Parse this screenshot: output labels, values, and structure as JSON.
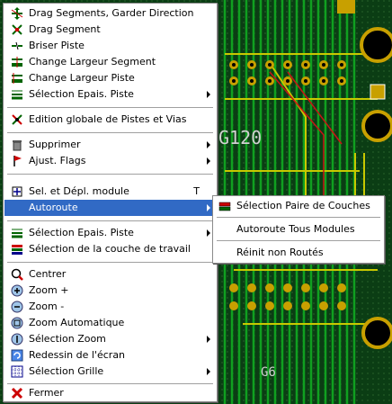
{
  "board": {
    "silk_labels": [
      "G120",
      "G6"
    ]
  },
  "menu": {
    "items": [
      {
        "label": "Drag Segments, Garder Direction",
        "icon": "drag-segments-icon",
        "submenu": false
      },
      {
        "label": "Drag Segment",
        "icon": "drag-segment-icon",
        "submenu": false
      },
      {
        "label": "Briser Piste",
        "icon": "break-track-icon",
        "submenu": false
      },
      {
        "label": "Change Largeur Segment",
        "icon": "width-segment-icon",
        "submenu": false
      },
      {
        "label": "Change Largeur Piste",
        "icon": "width-track-icon",
        "submenu": false
      },
      {
        "label": "Sélection Epais. Piste",
        "icon": "track-thickness-icon",
        "submenu": true
      },
      {
        "label": "Edition globale de Pistes et Vias",
        "icon": "global-edit-icon",
        "submenu": false
      },
      {
        "label": "Supprimer",
        "icon": "trash-icon",
        "submenu": true
      },
      {
        "label": "Ajust. Flags",
        "icon": "flag-icon",
        "submenu": true
      },
      {
        "label": "Sel. et Dépl. module",
        "icon": "select-module-icon",
        "submenu": false,
        "shortcut": "T"
      },
      {
        "label": "Autoroute",
        "icon": "",
        "submenu": true,
        "highlighted": true
      },
      {
        "label": "Sélection Epais. Piste",
        "icon": "track-thickness-icon",
        "submenu": true
      },
      {
        "label": "Sélection de la couche de travail",
        "icon": "layers-icon",
        "submenu": false
      },
      {
        "label": "Centrer",
        "icon": "center-icon",
        "submenu": false
      },
      {
        "label": "Zoom +",
        "icon": "zoom-in-icon",
        "submenu": false
      },
      {
        "label": "Zoom -",
        "icon": "zoom-out-icon",
        "submenu": false
      },
      {
        "label": "Zoom Automatique",
        "icon": "zoom-auto-icon",
        "submenu": false
      },
      {
        "label": "Sélection Zoom",
        "icon": "zoom-select-icon",
        "submenu": true
      },
      {
        "label": "Redessin de l'écran",
        "icon": "redraw-icon",
        "submenu": false
      },
      {
        "label": "Sélection Grille",
        "icon": "grid-icon",
        "submenu": true
      },
      {
        "label": "Fermer",
        "icon": "close-icon",
        "submenu": false
      }
    ]
  },
  "autoroute_submenu": {
    "items": [
      {
        "label": "Sélection Paire de Couches",
        "icon": "layer-pair-icon"
      },
      {
        "label": "Autoroute Tous Modules",
        "icon": ""
      },
      {
        "label": "Réinit non Routés",
        "icon": ""
      }
    ]
  },
  "colors": {
    "pcb_bg": "#0b3d14",
    "highlight": "#316ac5",
    "track_yellow": "#c8c800",
    "pad": "#c8a000",
    "track_red": "#c81414"
  }
}
